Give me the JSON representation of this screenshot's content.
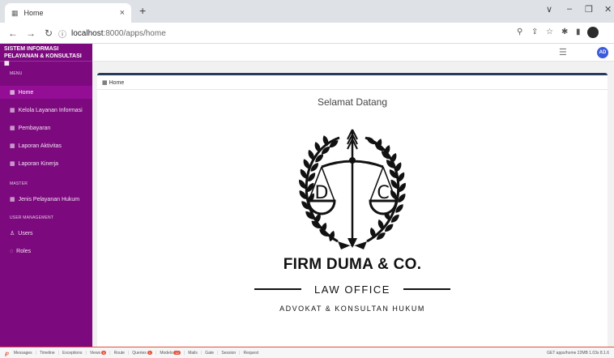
{
  "browser": {
    "tab_title": "Home",
    "tab_close": "×",
    "new_tab": "+",
    "window": {
      "min": "–",
      "max": "❐",
      "close": "✕",
      "chevron": "∨"
    },
    "url_host": "localhost",
    "url_path": ":8000/apps/home",
    "icons": [
      "back-icon",
      "forward-icon",
      "reload-icon",
      "info-icon",
      "zoom-icon",
      "share-icon",
      "star-icon",
      "extension-icon",
      "sidepanel-icon"
    ]
  },
  "sidebar": {
    "brand": "SISTEM INFORMASI PELAYANAN & KONSULTASI",
    "sections": [
      {
        "label": "MENU"
      },
      {
        "label": "MASTER"
      },
      {
        "label": "USER MANAGEMENT"
      }
    ],
    "items": [
      {
        "label": "Home",
        "icon": "▦",
        "active": true
      },
      {
        "label": "Kelola Layanan Informasi",
        "icon": "▦"
      },
      {
        "label": "Pembayaran",
        "icon": "▦"
      },
      {
        "label": "Laporan Aktivitas",
        "icon": "▦"
      },
      {
        "label": "Laporan Kinerja",
        "icon": "▦"
      },
      {
        "label": "Jenis Pelayanan Hukum",
        "icon": "▦"
      },
      {
        "label": "Users",
        "icon": "♙"
      },
      {
        "label": "Roles",
        "icon": "◌"
      }
    ]
  },
  "appbar": {
    "avatar": "AD"
  },
  "content": {
    "breadcrumb": "Home",
    "welcome": "Selamat Datang",
    "logo_letters": {
      "left": "D",
      "right": "C"
    },
    "firm_name": "FIRM DUMA & CO.",
    "law_office": "LAW OFFICE",
    "tagline": "ADVOKAT & KONSULTAN HUKUM"
  },
  "debugbar": {
    "tabs": [
      {
        "label": "Messages"
      },
      {
        "label": "Timeline"
      },
      {
        "label": "Exceptions"
      },
      {
        "label": "Views",
        "badge": "5"
      },
      {
        "label": "Route"
      },
      {
        "label": "Queries",
        "badge": "1"
      },
      {
        "label": "Models",
        "badge": "12"
      },
      {
        "label": "Mails"
      },
      {
        "label": "Gate"
      },
      {
        "label": "Session"
      },
      {
        "label": "Request"
      }
    ],
    "status": "GET apps/home  22MB  1.03s  8.1.6"
  },
  "colors": {
    "sidebar": "#7c0a7e",
    "accent": "#e3513b",
    "avatar": "#3b5bdb"
  }
}
